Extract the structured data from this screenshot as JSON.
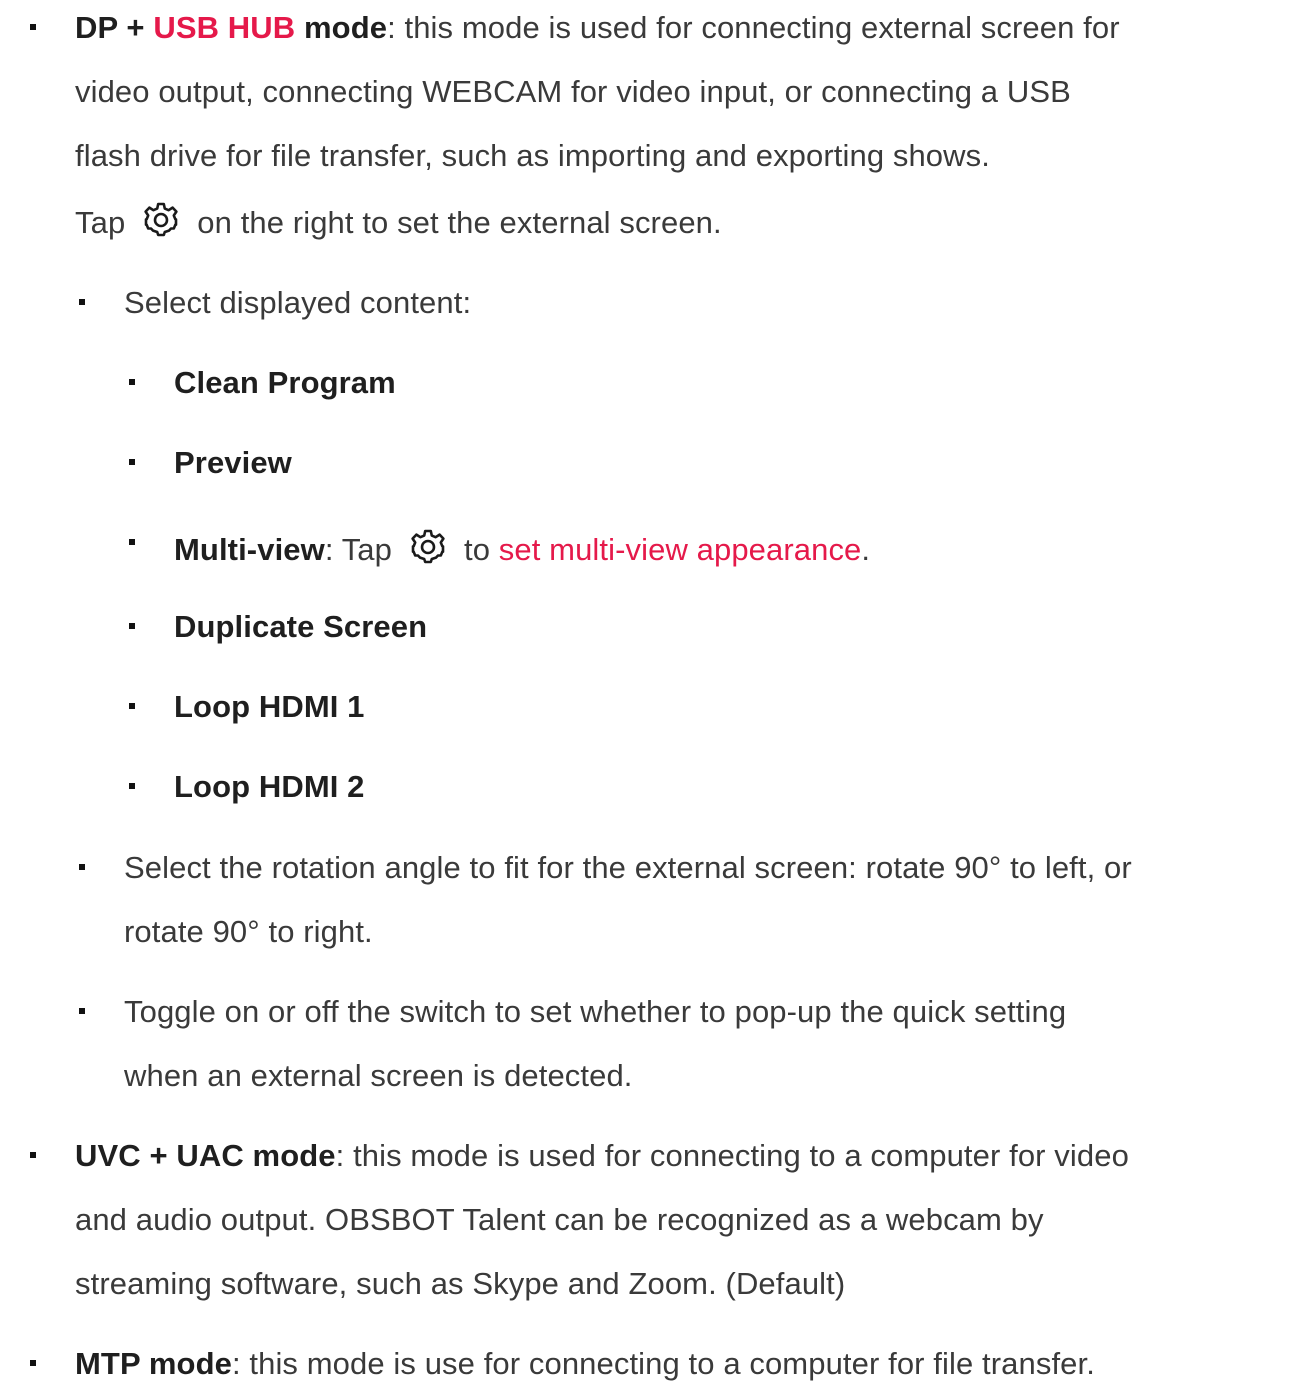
{
  "colors": {
    "accent": "#e5194a",
    "text": "#3a3a3a",
    "bold_text": "#1f1f1f",
    "bullet": "#111111"
  },
  "dp_mode": {
    "title_dp": "DP + ",
    "title_usbhub": "USB HUB",
    "title_mode": " mode",
    "line1_rest": ": this mode is used for connecting external screen for",
    "line2": "video output, connecting WEBCAM for video input, or connecting a USB",
    "line3": "flash drive for file transfer, such as importing and exporting shows.",
    "line4_pre": "Tap",
    "line4_post": "on the right to set the external screen.",
    "gear_icon": "gear-icon",
    "sub_content": {
      "label": "Select displayed content:",
      "options": {
        "clean_program": "Clean Program",
        "preview": "Preview",
        "multiview_label": "Multi-view",
        "multiview_tap": ": Tap",
        "multiview_to": "to",
        "multiview_link": "set multi-view appearance",
        "multiview_end": ".",
        "duplicate_screen": "Duplicate Screen",
        "loop_hdmi_1": "Loop HDMI 1",
        "loop_hdmi_2": "Loop HDMI 2"
      }
    },
    "sub_rotation": {
      "line1": "Select the rotation angle to fit for the external screen: rotate 90° to left, or",
      "line2": "rotate 90° to right."
    },
    "sub_toggle": {
      "line1": "Toggle on or off the switch to set whether to pop-up the quick setting",
      "line2": "when an external screen is detected."
    }
  },
  "uvc_mode": {
    "title": "UVC + UAC mode",
    "line1_rest": ": this mode is used for connecting to a computer for video",
    "line2": "and audio output. OBSBOT Talent can be recognized as a webcam by",
    "line3": "streaming software, such as Skype and Zoom. (Default)"
  },
  "mtp_mode": {
    "title": "MTP mode",
    "line1_rest": ": this mode is use for connecting to a computer for file transfer."
  }
}
